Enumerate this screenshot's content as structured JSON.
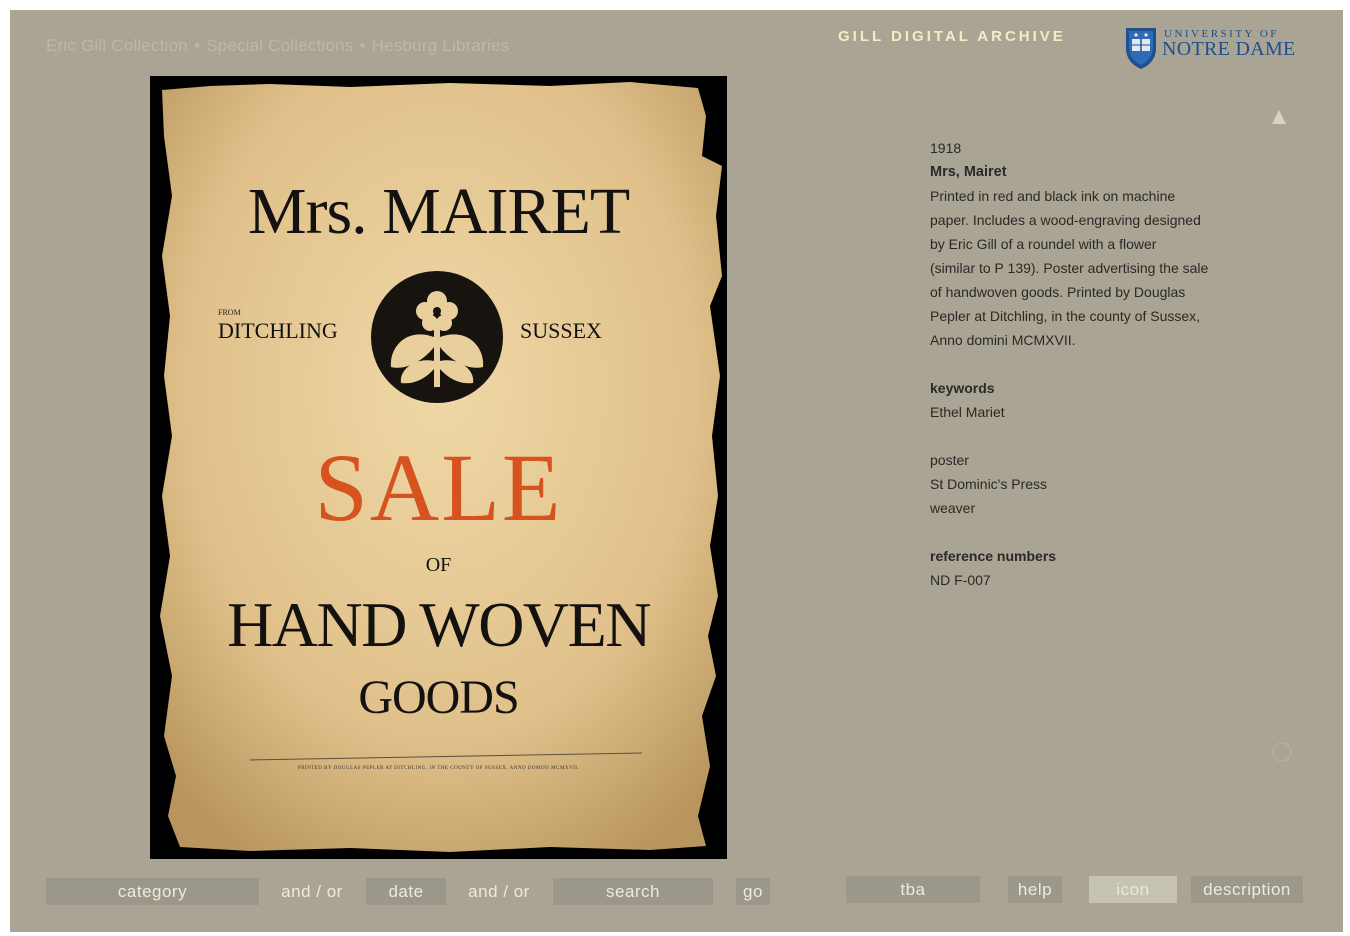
{
  "header": {
    "breadcrumb": [
      "Eric Gill Collection",
      "Special Collections",
      "Hesburg Libraries"
    ],
    "breadcrumb_sep": "•",
    "brand": "GILL DIGITAL ARCHIVE",
    "logo_top": "UNIVERSITY OF",
    "logo_bottom": "NOTRE DAME"
  },
  "poster": {
    "title": "Mrs. MAIRET",
    "from": "FROM",
    "left": "DITCHLING",
    "right": "SUSSEX",
    "sale": "SALE",
    "of": "OF",
    "line1": "HAND WOVEN",
    "line2": "GOODS",
    "printed": "PRINTED BY DOUGLAS PEPLER AT DITCHLING, IN THE COUNTY OF SUSSEX, ANNO DOMINI MCMXVII."
  },
  "details": {
    "year": "1918",
    "title": "Mrs, Mairet",
    "description": [
      "Printed in red and black ink on machine",
      "paper.  Includes a wood-engraving designed",
      "by Eric Gill of a roundel with a flower",
      "(similar to P 139). Poster advertising the sale",
      "of handwoven goods.  Printed by Douglas",
      "Pepler at Ditchling, in the county of Sussex,",
      "Anno domini MCMXVII."
    ],
    "keywords_label": "keywords",
    "keywords": [
      "Ethel Mariet"
    ],
    "tags": [
      "poster",
      "St Dominic's Press",
      "weaver"
    ],
    "ref_label": "reference numbers",
    "refs": [
      "ND F-007"
    ]
  },
  "toolbar": {
    "category": "category",
    "andor1": "and / or",
    "date": "date",
    "andor2": "and / or",
    "search": "search",
    "go": "go",
    "tba": "tba",
    "help": "help",
    "icon": "icon",
    "description": "description"
  },
  "colors": {
    "background": "#a9a494",
    "brand_text": "#f4ecc8",
    "poster_red": "#d6521f",
    "logo_blue": "#1f4f8f"
  },
  "icons": [
    "up-arrow-icon",
    "shield-icon"
  ]
}
